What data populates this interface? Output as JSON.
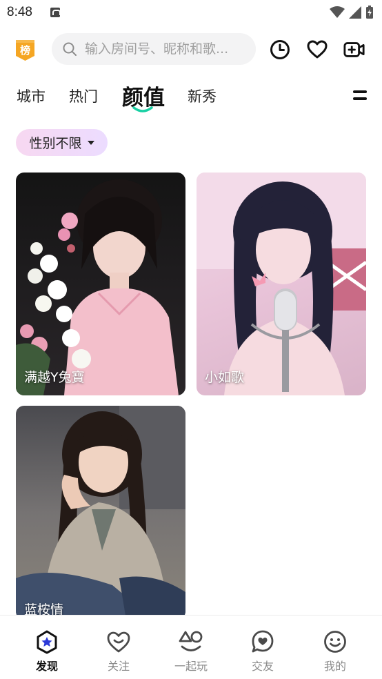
{
  "status_bar": {
    "time": "8:48"
  },
  "header": {
    "rank_badge": "榜",
    "search_placeholder": "输入房间号、昵称和歌..."
  },
  "tabs": [
    {
      "label": "城市",
      "active": false
    },
    {
      "label": "热门",
      "active": false
    },
    {
      "label": "颜值",
      "active": true
    },
    {
      "label": "新秀",
      "active": false
    }
  ],
  "filter": {
    "label": "性别不限"
  },
  "cards": [
    {
      "name": "满越Y兔寶"
    },
    {
      "name": "小如歌"
    },
    {
      "name": "蓝桉情"
    }
  ],
  "bottom_nav": [
    {
      "label": "发现",
      "icon": "discover-icon",
      "active": true
    },
    {
      "label": "关注",
      "icon": "heart-smile-icon",
      "active": false
    },
    {
      "label": "一起玩",
      "icon": "shapes-icon",
      "active": false
    },
    {
      "label": "交友",
      "icon": "chat-heart-icon",
      "active": false
    },
    {
      "label": "我的",
      "icon": "smiley-icon",
      "active": false
    }
  ],
  "colors": {
    "accent": "#19d0a4",
    "badge": "#f5a623",
    "chip": "#f3d9f2"
  }
}
